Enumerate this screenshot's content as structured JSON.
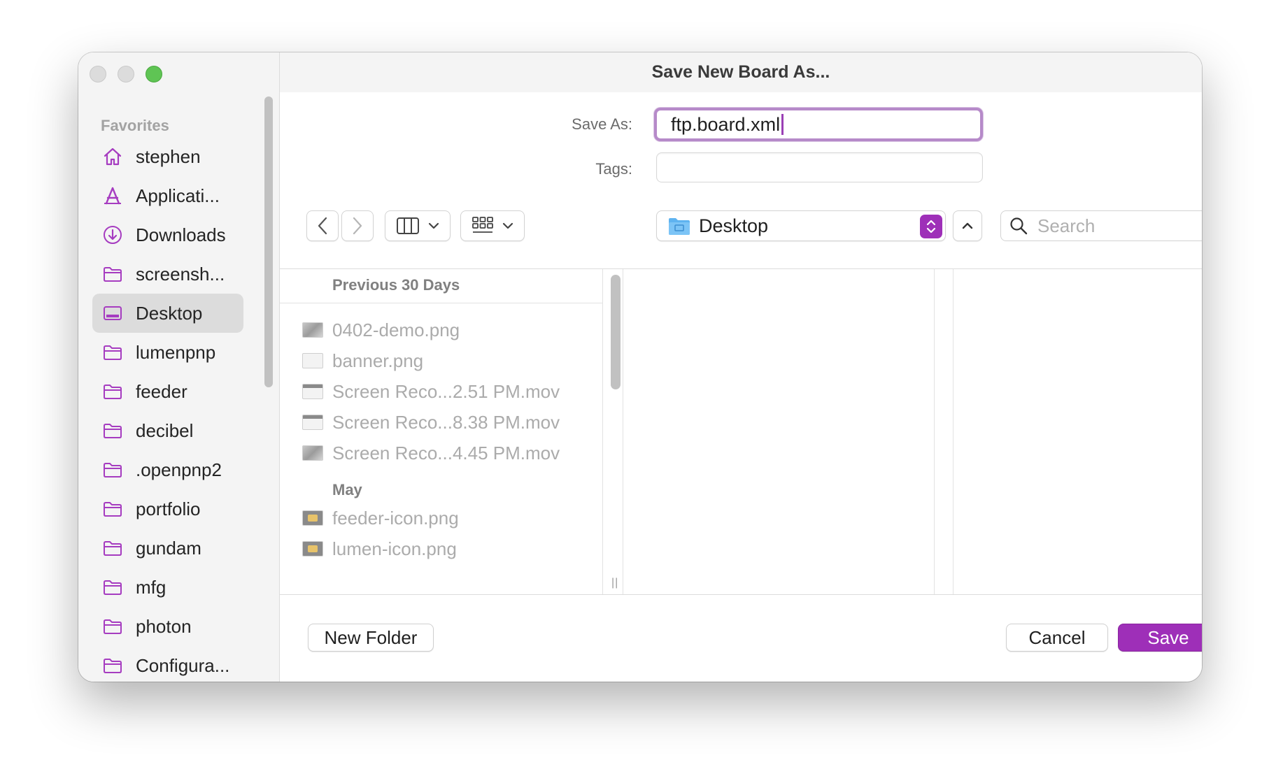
{
  "window": {
    "title": "Save New Board As..."
  },
  "sidebar": {
    "section_title": "Favorites",
    "items": [
      {
        "label": "stephen",
        "icon": "home-icon"
      },
      {
        "label": "Applicati...",
        "icon": "applications-icon"
      },
      {
        "label": "Downloads",
        "icon": "downloads-icon"
      },
      {
        "label": "screensh...",
        "icon": "folder-icon"
      },
      {
        "label": "Desktop",
        "icon": "desktop-icon",
        "selected": true
      },
      {
        "label": "lumenpnp",
        "icon": "folder-icon"
      },
      {
        "label": "feeder",
        "icon": "folder-icon"
      },
      {
        "label": "decibel",
        "icon": "folder-icon"
      },
      {
        "label": ".openpnp2",
        "icon": "folder-icon"
      },
      {
        "label": "portfolio",
        "icon": "folder-icon"
      },
      {
        "label": "gundam",
        "icon": "folder-icon"
      },
      {
        "label": "mfg",
        "icon": "folder-icon"
      },
      {
        "label": "photon",
        "icon": "folder-icon"
      },
      {
        "label": "Configura...",
        "icon": "folder-icon"
      }
    ]
  },
  "form": {
    "save_as_label": "Save As:",
    "save_as_value": "ftp.board.xml",
    "tags_label": "Tags:",
    "tags_value": ""
  },
  "toolbar": {
    "location": "Desktop",
    "search_placeholder": "Search"
  },
  "browser": {
    "sections": [
      {
        "title": "Previous 30 Days",
        "files": [
          {
            "name": "0402-demo.png",
            "thumb": "pic"
          },
          {
            "name": "banner.png",
            "thumb": "plain"
          },
          {
            "name": "Screen Reco...2.51 PM.mov",
            "thumb": "dark"
          },
          {
            "name": "Screen Reco...8.38 PM.mov",
            "thumb": "dark"
          },
          {
            "name": "Screen Reco...4.45 PM.mov",
            "thumb": "pic"
          }
        ]
      },
      {
        "title": "May",
        "files": [
          {
            "name": "feeder-icon.png",
            "thumb": "icon-pic"
          },
          {
            "name": "lumen-icon.png",
            "thumb": "icon-pic"
          }
        ]
      }
    ]
  },
  "footer": {
    "new_folder_label": "New Folder",
    "cancel_label": "Cancel",
    "save_label": "Save"
  },
  "colors": {
    "accent": "#9e2fb8",
    "focus_ring": "#b68ac9",
    "sidebar_icon": "#a63cc0",
    "traffic_close": "#dcdcdc",
    "traffic_max": "#5fc454"
  }
}
